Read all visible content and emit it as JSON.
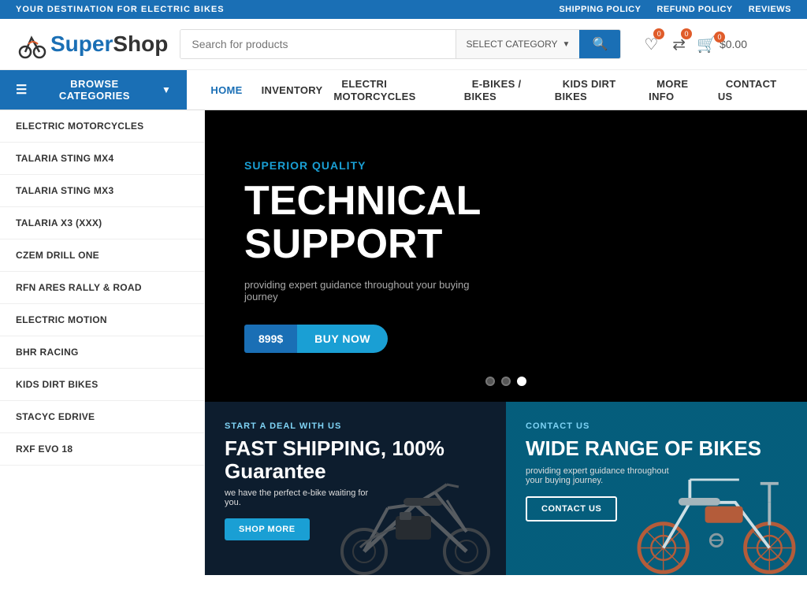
{
  "topbar": {
    "tagline": "YOUR DESTINATION FOR ELECTRIC BIKES",
    "links": [
      {
        "id": "shipping",
        "label": "SHIPPING POLICY"
      },
      {
        "id": "refund",
        "label": "REFUND POLICY"
      },
      {
        "id": "reviews",
        "label": "REVIEWS"
      }
    ]
  },
  "header": {
    "logo_super": "Super",
    "logo_shop": "Shop",
    "search_placeholder": "Search for products",
    "select_category": "SELECT CATEGORY",
    "search_icon": "🔍",
    "wishlist_count": "",
    "compare_count": "",
    "cart_count": "0",
    "cart_price": "$0.00"
  },
  "nav": {
    "browse_label": "BROWSE CATEGORIES",
    "items": [
      {
        "id": "home",
        "label": "HOME",
        "active": true
      },
      {
        "id": "inventory",
        "label": "INVENTORY"
      },
      {
        "id": "electri-motorcycles",
        "label": "ELECTRI MOTORCYCLES"
      },
      {
        "id": "ebikes",
        "label": "E-BIKES / BIKES"
      },
      {
        "id": "kids-dirt-bikes",
        "label": "KIDS DIRT BIKES"
      },
      {
        "id": "more-info",
        "label": "MORE INFO"
      },
      {
        "id": "contact",
        "label": "CONTACT US"
      }
    ]
  },
  "sidebar": {
    "items": [
      {
        "id": "electric-motorcycles",
        "label": "ELECTRIC MOTORCYCLES"
      },
      {
        "id": "talaria-mx4",
        "label": "TALARIA STING MX4"
      },
      {
        "id": "talaria-mx3",
        "label": "TALARIA STING MX3"
      },
      {
        "id": "talaria-x3",
        "label": "TALARIA X3 (XXX)"
      },
      {
        "id": "czem-drill-one",
        "label": "CZEM DRILL ONE"
      },
      {
        "id": "rfn-ares",
        "label": "RFN ARES RALLY & ROAD"
      },
      {
        "id": "electric-motion",
        "label": "ELECTRIC MOTION"
      },
      {
        "id": "bhr-racing",
        "label": "BHR RACING"
      },
      {
        "id": "kids-dirt-bikes",
        "label": "KIDS DIRT BIKES"
      },
      {
        "id": "stacyc-edrive",
        "label": "STACYC EDRIVE"
      },
      {
        "id": "rxf-evo-18",
        "label": "RXF EVO 18"
      }
    ]
  },
  "hero": {
    "tag": "SUPERIOR QUALITY",
    "title_line1": "TECHNICAL",
    "title_line2": "SUPPORT",
    "description": "providing expert guidance throughout your buying journey",
    "price": "899$",
    "buy_label": "BUY NOW",
    "dots": [
      {
        "id": "dot1",
        "active": false
      },
      {
        "id": "dot2",
        "active": false
      },
      {
        "id": "dot3",
        "active": true
      }
    ]
  },
  "cards": {
    "left": {
      "tag": "START A DEAL WITH US",
      "title": "FAST SHIPPING, 100% Guarantee",
      "description": "we have the perfect e-bike waiting for you.",
      "btn_label": "SHOP MORE"
    },
    "right": {
      "tag": "CONTACT US",
      "title": "WIDE RANGE OF BIKES",
      "description": "providing expert guidance throughout your buying journey.",
      "btn_label": "CONTACT US"
    }
  }
}
